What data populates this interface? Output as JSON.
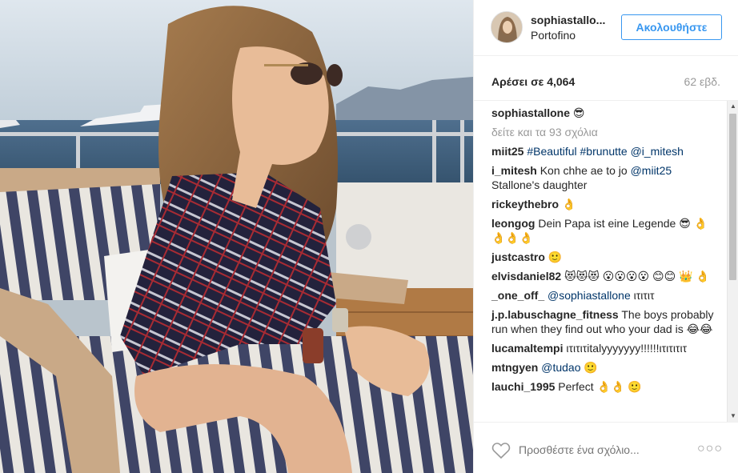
{
  "header": {
    "username": "sophiastallo...",
    "location": "Portofino",
    "follow_label": "Ακολουθήστε"
  },
  "stats": {
    "likes": "Αρέσει σε 4,064",
    "age": "62 εβδ."
  },
  "caption": {
    "user": "sophiastallone",
    "text": "😎"
  },
  "view_all": "δείτε και τα 93 σχόλια",
  "comments": [
    {
      "user": "miit25",
      "text": "",
      "tags": "#Beautiful #brunutte @i_mitesh"
    },
    {
      "user": "i_mitesh",
      "text": "Kon chhe ae to jo ",
      "tags": "@miit25",
      "text2": " Stallone's daughter"
    },
    {
      "user": "rickeythebro",
      "text": "👌",
      "tags": ""
    },
    {
      "user": "leongog",
      "text": "Dein Papa ist eine Legende 😎 👌👌👌👌",
      "tags": ""
    },
    {
      "user": "justcastro",
      "text": "🙂",
      "tags": ""
    },
    {
      "user": "elvisdaniel82",
      "text": "😻😻😻 😮😮😮😮 😊😊 👑 👌",
      "tags": ""
    },
    {
      "user": "_one_off_",
      "text": "",
      "tags": "@sophiastallone",
      "text2": " ιτιτιτ"
    },
    {
      "user": "j.p.labuschagne_fitness",
      "text": "The boys probably run when they find out who your dad is 😂😂",
      "tags": ""
    },
    {
      "user": "lucamaltempi",
      "text": "ιτιτιτitalyyyyyyy!!!!!!ιτιτιτιτ",
      "tags": ""
    },
    {
      "user": "mtngyen",
      "text": "",
      "tags": "@tudao",
      "text2": " 🙂"
    },
    {
      "user": "lauchi_1995",
      "text": "Perfect 👌👌 🙂",
      "tags": ""
    }
  ],
  "footer": {
    "comment_placeholder": "Προσθέστε ένα σχόλιο...",
    "more_label": "○○○"
  },
  "colors": {
    "accent": "#3897f0",
    "tag": "#003569",
    "muted": "#999999",
    "border": "#efefef"
  }
}
